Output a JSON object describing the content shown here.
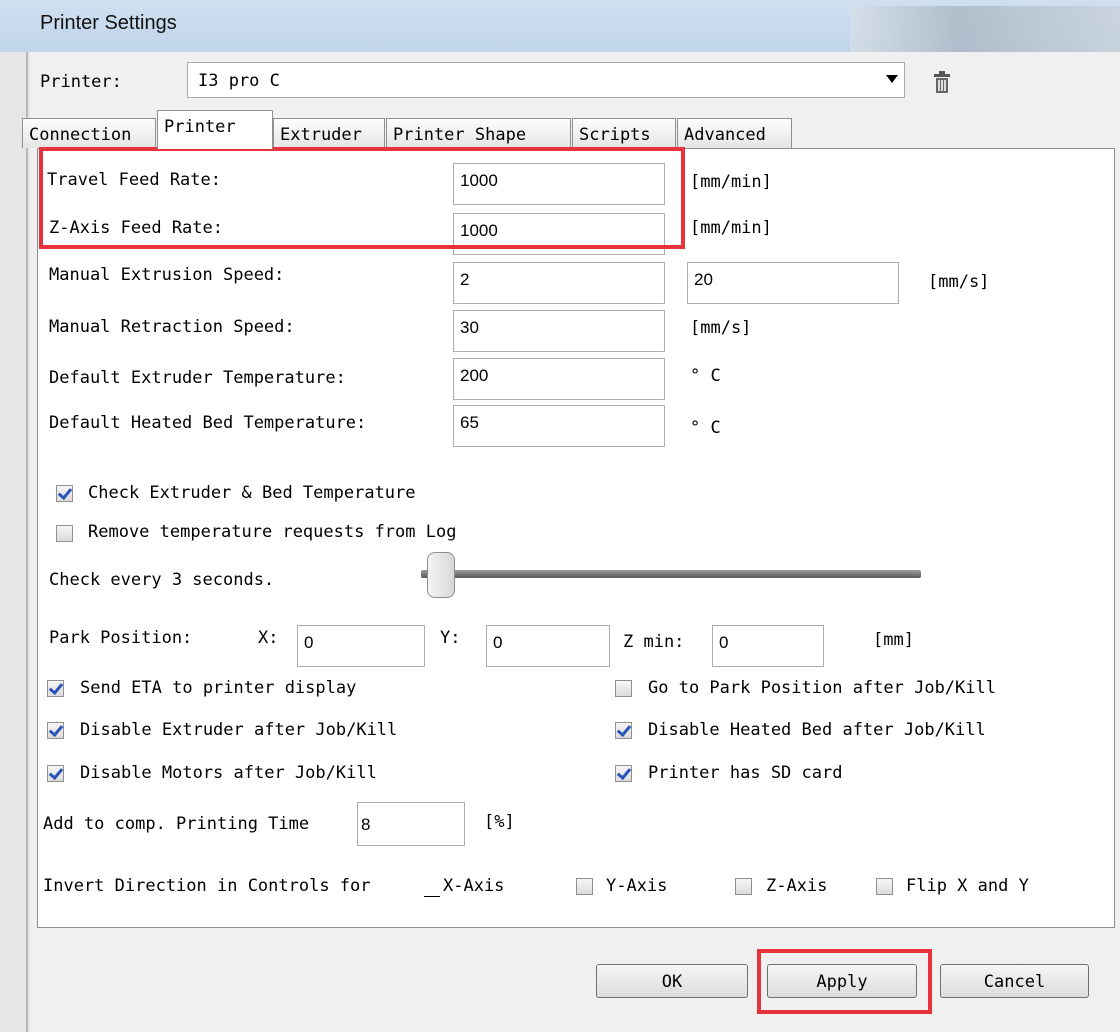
{
  "window": {
    "title": "Printer Settings"
  },
  "printer": {
    "label": "Printer:",
    "selected": "I3 pro C"
  },
  "tabs": [
    "Connection",
    "Printer",
    "Extruder",
    "Printer Shape",
    "Scripts",
    "Advanced"
  ],
  "active_tab": "Printer",
  "fields": {
    "travel_feed_rate": {
      "label": "Travel Feed Rate:",
      "value": "1000",
      "unit": "[mm/min]"
    },
    "z_axis_feed_rate": {
      "label": "Z-Axis Feed Rate:",
      "value": "1000",
      "unit": "[mm/min]"
    },
    "manual_extrusion_speed": {
      "label": "Manual Extrusion Speed:",
      "value1": "2",
      "value2": "20",
      "unit": "[mm/s]"
    },
    "manual_retraction_speed": {
      "label": "Manual Retraction Speed:",
      "value": "30",
      "unit": "[mm/s]"
    },
    "default_extruder_temp": {
      "label": "Default Extruder Temperature:",
      "value": "200",
      "unit": "° C"
    },
    "default_bed_temp": {
      "label": "Default Heated Bed Temperature:",
      "value": "65",
      "unit": "° C"
    }
  },
  "checks": {
    "check_temp": {
      "label": "Check Extruder & Bed Temperature",
      "checked": true
    },
    "remove_temp_requests": {
      "label": "Remove temperature requests from Log",
      "checked": false
    }
  },
  "check_interval": {
    "label": "Check every 3 seconds.",
    "seconds": 3
  },
  "park": {
    "label": "Park Position:",
    "x_label": "X:",
    "x": "0",
    "y_label": "Y:",
    "y": "0",
    "z_label": "Z min:",
    "z": "0",
    "unit": "[mm]"
  },
  "options": {
    "send_eta": {
      "label": "Send ETA to printer display",
      "checked": true
    },
    "go_to_park": {
      "label": "Go to Park Position after Job/Kill",
      "checked": false
    },
    "disable_extruder": {
      "label": "Disable Extruder after Job/Kill",
      "checked": true
    },
    "disable_bed": {
      "label": "Disable Heated Bed after Job/Kill",
      "checked": true
    },
    "disable_motors": {
      "label": "Disable Motors after Job/Kill",
      "checked": true
    },
    "has_sd": {
      "label": "Printer has SD card",
      "checked": true
    }
  },
  "comp_time": {
    "label": "Add to comp. Printing Time",
    "value": "8",
    "unit": "[%]"
  },
  "invert": {
    "label": "Invert Direction in Controls for",
    "x_axis": {
      "label": "X-Axis"
    },
    "y_axis": {
      "label": "Y-Axis",
      "checked": false
    },
    "z_axis": {
      "label": "Z-Axis",
      "checked": false
    },
    "flip": {
      "label": "Flip X and Y",
      "checked": false
    }
  },
  "buttons": {
    "ok": "OK",
    "apply": "Apply",
    "cancel": "Cancel"
  },
  "colors": {
    "highlight": "#e8323c",
    "check": "#2a55b8"
  }
}
